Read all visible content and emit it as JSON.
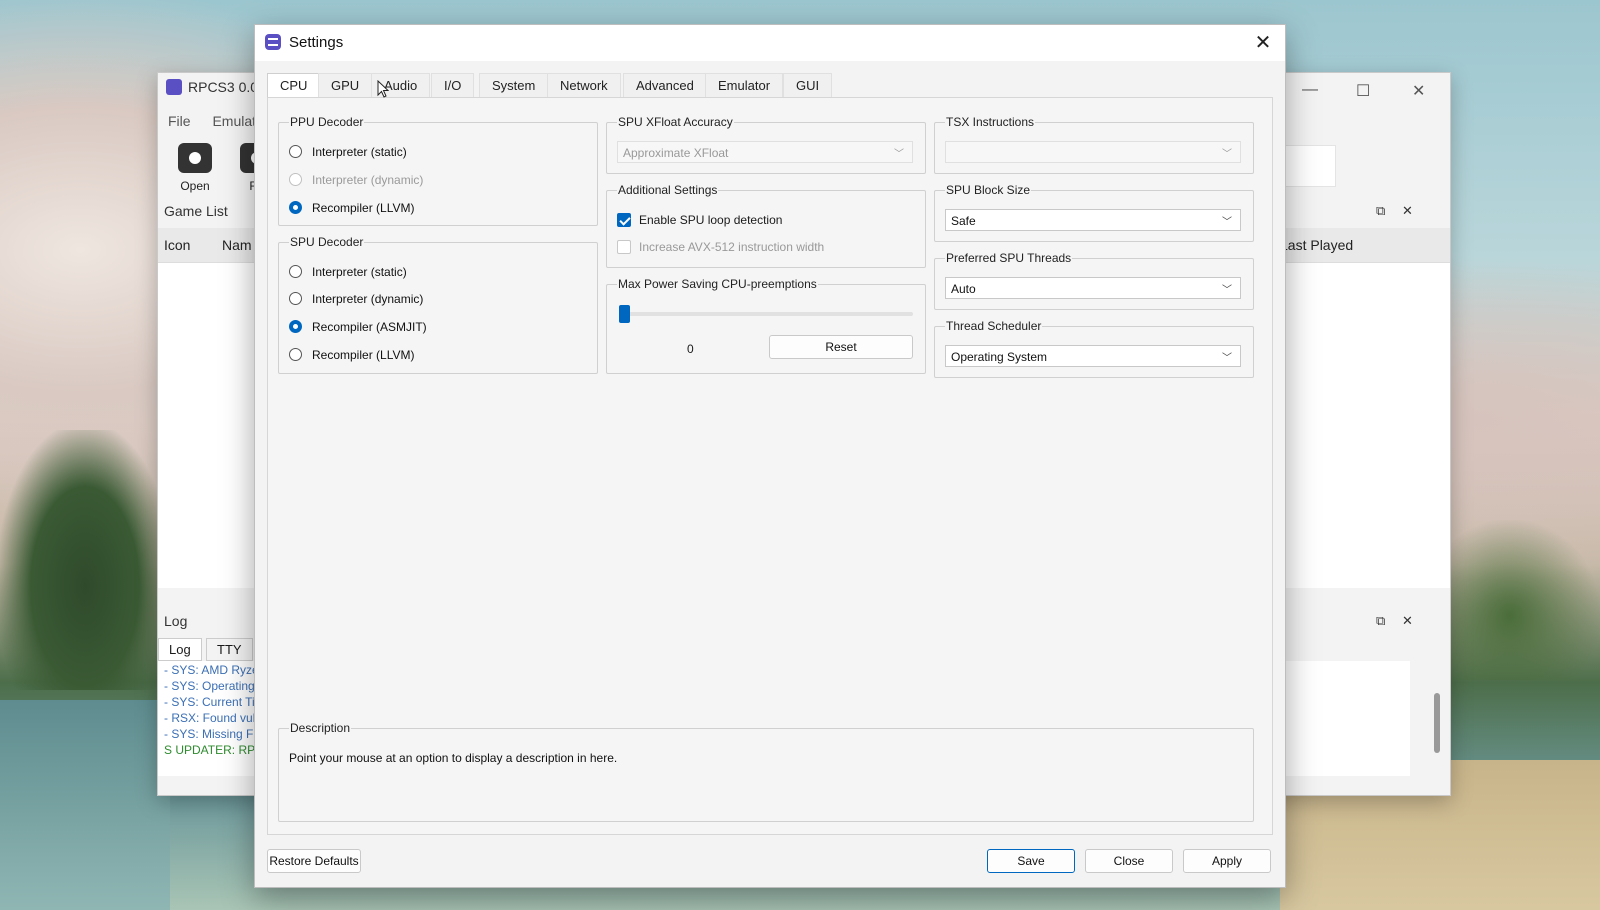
{
  "main_window": {
    "title": "RPCS3 0.0",
    "menu": [
      "File",
      "Emulati"
    ],
    "toolbar": [
      {
        "label": "Open",
        "icon": "camera-icon"
      },
      {
        "label": "Re",
        "icon": "refresh-icon"
      }
    ],
    "game_list_label": "Game List",
    "columns": {
      "icon": "Icon",
      "name": "Nam",
      "last_played": "Last Played"
    },
    "log_label": "Log",
    "log_tabs": [
      "Log",
      "TTY"
    ],
    "log_lines": [
      {
        "text": "- SYS: AMD Ryze",
        "color": "#3b6fb5"
      },
      {
        "text": "- SYS: Operating",
        "color": "#3b6fb5"
      },
      {
        "text": "- SYS: Current Ti",
        "color": "#3b6fb5"
      },
      {
        "text": "- RSX: Found vul",
        "color": "#3b6fb5"
      },
      {
        "text": "- SYS: Missing Fi",
        "color": "#3b6fb5"
      },
      {
        "text": "S UPDATER: RPC",
        "color": "#2e8b2e"
      }
    ]
  },
  "dialog": {
    "title": "Settings",
    "tabs": [
      "CPU",
      "GPU",
      "Audio",
      "I/O",
      "System",
      "Network",
      "Advanced",
      "Emulator",
      "GUI"
    ],
    "active_tab": "CPU",
    "ppu_decoder": {
      "title": "PPU Decoder",
      "options": [
        {
          "label": "Interpreter (static)",
          "state": "unchecked"
        },
        {
          "label": "Interpreter (dynamic)",
          "state": "disabled"
        },
        {
          "label": "Recompiler (LLVM)",
          "state": "checked"
        }
      ]
    },
    "spu_decoder": {
      "title": "SPU Decoder",
      "options": [
        {
          "label": "Interpreter (static)",
          "state": "unchecked"
        },
        {
          "label": "Interpreter (dynamic)",
          "state": "unchecked"
        },
        {
          "label": "Recompiler (ASMJIT)",
          "state": "checked"
        },
        {
          "label": "Recompiler (LLVM)",
          "state": "unchecked"
        }
      ]
    },
    "spu_xfloat": {
      "title": "SPU XFloat Accuracy",
      "value": "Approximate XFloat"
    },
    "additional": {
      "title": "Additional Settings",
      "loop_detection": "Enable SPU loop detection",
      "avx512": "Increase AVX-512 instruction width"
    },
    "preemptions": {
      "title": "Max Power Saving CPU-preemptions",
      "value": "0",
      "reset_label": "Reset",
      "slider_fraction": 0
    },
    "tsx": {
      "title": "TSX Instructions",
      "value": ""
    },
    "spu_block_size": {
      "title": "SPU Block Size",
      "value": "Safe"
    },
    "spu_threads": {
      "title": "Preferred SPU Threads",
      "value": "Auto"
    },
    "thread_scheduler": {
      "title": "Thread Scheduler",
      "value": "Operating System"
    },
    "description": {
      "title": "Description",
      "text": "Point your mouse at an option to display a description in here."
    },
    "buttons": {
      "restore": "Restore Defaults",
      "save": "Save",
      "close": "Close",
      "apply": "Apply"
    },
    "accent_color": "#0067c0"
  }
}
